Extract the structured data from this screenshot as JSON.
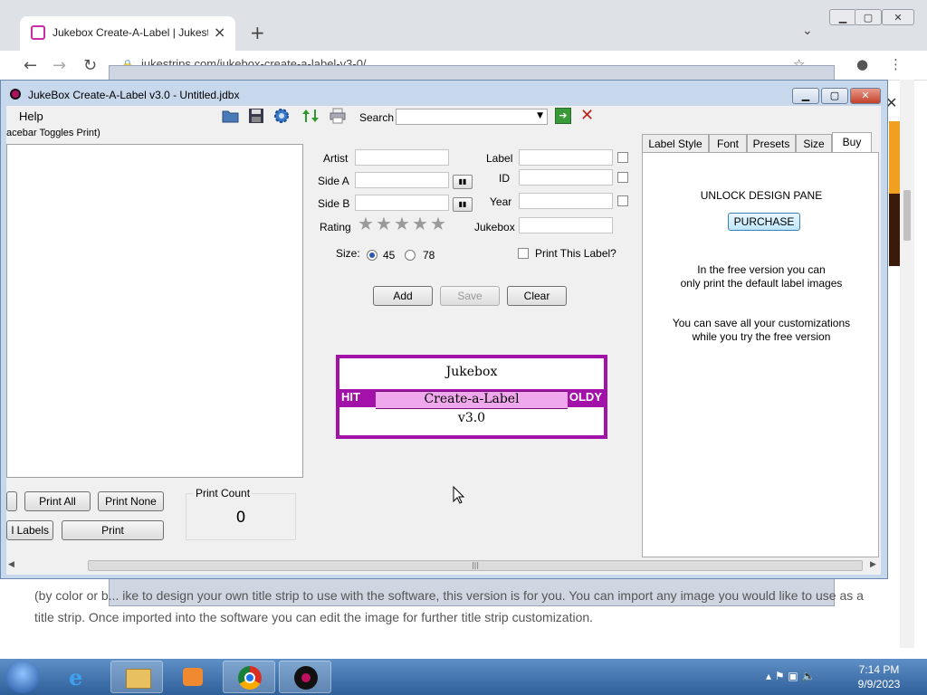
{
  "browser": {
    "tab_title": "Jukebox Create-A-Label | Jukestri",
    "url": "jukestrips.com/jukebox-create-a-label-v3-0/",
    "page_text": "(by color or b... ike to design your own title strip to use with the software, this version is for you. You can import any image you would like to use as a title strip. Once imported into the software you can edit the image for further title strip customization."
  },
  "app": {
    "title": "JukeBox Create-A-Label v3.0 - Untitled.jdbx",
    "menu_help": "Help",
    "hint": "acebar Toggles Print)",
    "search_label": "Search",
    "search_value": "",
    "form": {
      "artist_label": "Artist",
      "side_a_label": "Side A",
      "side_b_label": "Side B",
      "rating_label": "Rating",
      "label_label": "Label",
      "id_label": "ID",
      "year_label": "Year",
      "jukebox_label": "Jukebox",
      "size_label": "Size:",
      "size_45": "45",
      "size_78": "78",
      "selected_size": "45",
      "print_this_label": "Print This Label?",
      "rating_stars": 5,
      "rating_value": 0
    },
    "buttons": {
      "add": "Add",
      "save": "Save",
      "clear": "Clear",
      "print_all": "Print All",
      "print_none": "Print None",
      "labels": "l Labels",
      "print": "Print"
    },
    "label_preview": {
      "line1": "Jukebox",
      "line2": "Create-a-Label",
      "line3": "v3.0",
      "band_left": "HIT",
      "band_right": "OLDY",
      "color": "#a312a8"
    },
    "print_count": {
      "label": "Print Count",
      "value": "0"
    },
    "tabs": [
      "Label Style",
      "Font",
      "Presets",
      "Size",
      "Buy"
    ],
    "active_tab": "Buy",
    "buy_panel": {
      "heading": "UNLOCK DESIGN PANE",
      "purchase": "PURCHASE",
      "text1a": "In the free version you can",
      "text1b": "only print the default label images",
      "text2a": "You can save all your customizations",
      "text2b": "while you try the free version"
    }
  },
  "taskbar": {
    "time": "7:14 PM",
    "date": "9/9/2023"
  }
}
